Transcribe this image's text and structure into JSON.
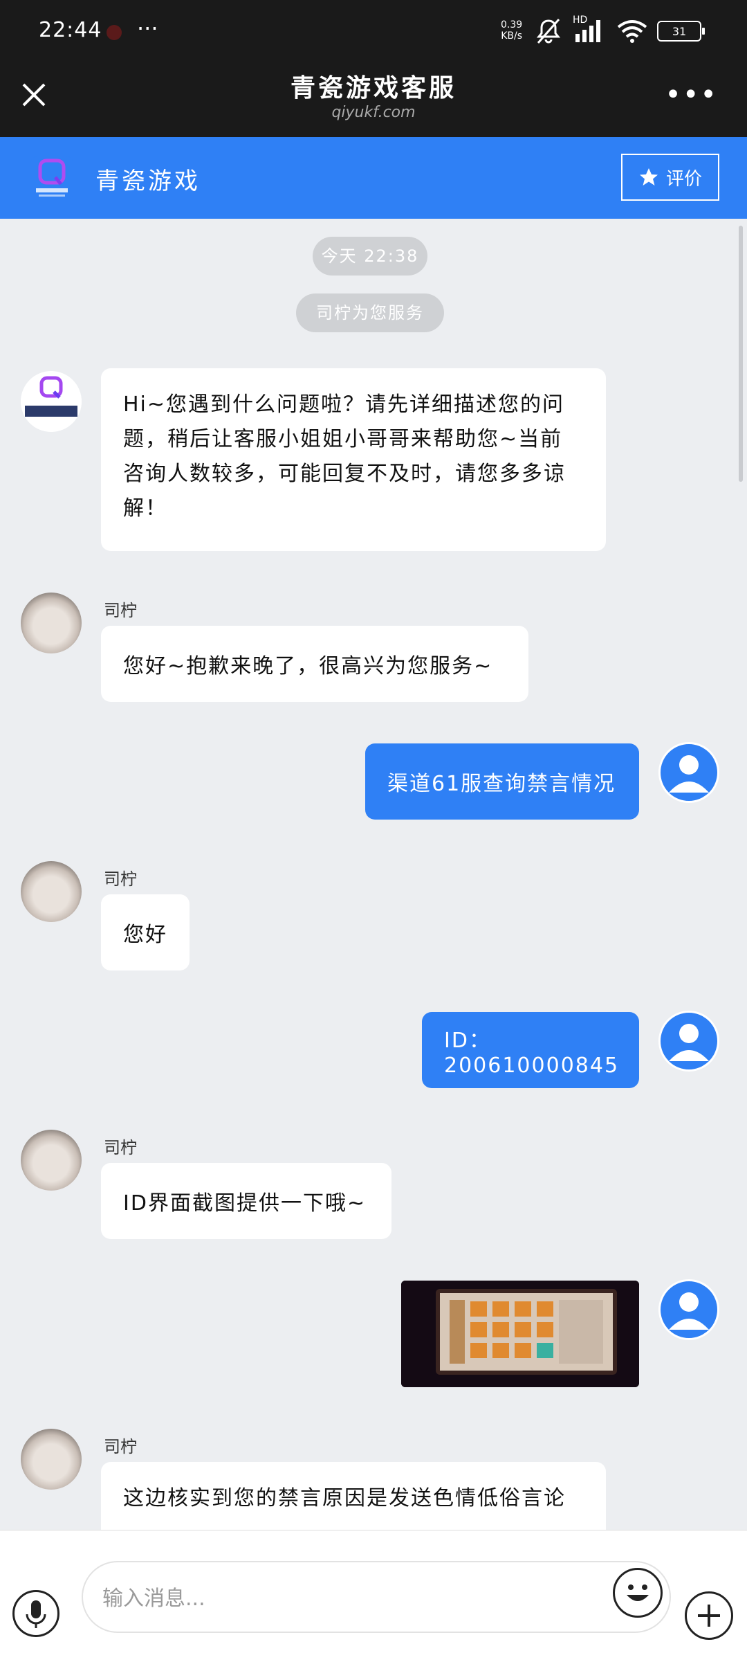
{
  "status_bar": {
    "time": "22:44",
    "more": "···",
    "speed_value": "0.39",
    "speed_unit": "KB/s",
    "network_label": "HD",
    "battery": "31"
  },
  "title_bar": {
    "title": "青瓷游戏客服",
    "subtitle": "qiyukf.com",
    "more": "•••"
  },
  "header": {
    "brand": "青瓷游戏",
    "rate_label": "评价",
    "colors": {
      "accent": "#2f80f5"
    }
  },
  "chat": {
    "timestamp": "今天 22:38",
    "service_notice": "司柠为您服务",
    "agent_name": "司柠",
    "messages": [
      {
        "from": "system",
        "text": "Hi~您遇到什么问题啦？请先详细描述您的问题，稍后让客服小姐姐小哥哥来帮助您~当前咨询人数较多，可能回复不及时，请您多多谅解！"
      },
      {
        "from": "agent",
        "text": "您好~抱歉来晚了，很高兴为您服务~"
      },
      {
        "from": "user",
        "text": "渠道61服查询禁言情况"
      },
      {
        "from": "agent",
        "text": "您好"
      },
      {
        "from": "user",
        "text": "ID：200610000845"
      },
      {
        "from": "agent",
        "text": "ID界面截图提供一下哦~"
      },
      {
        "from": "user",
        "type": "image"
      },
      {
        "from": "agent",
        "text": "这边核实到您的禁言原因是发送色情低俗言论"
      }
    ]
  },
  "input": {
    "placeholder": "输入消息..."
  }
}
